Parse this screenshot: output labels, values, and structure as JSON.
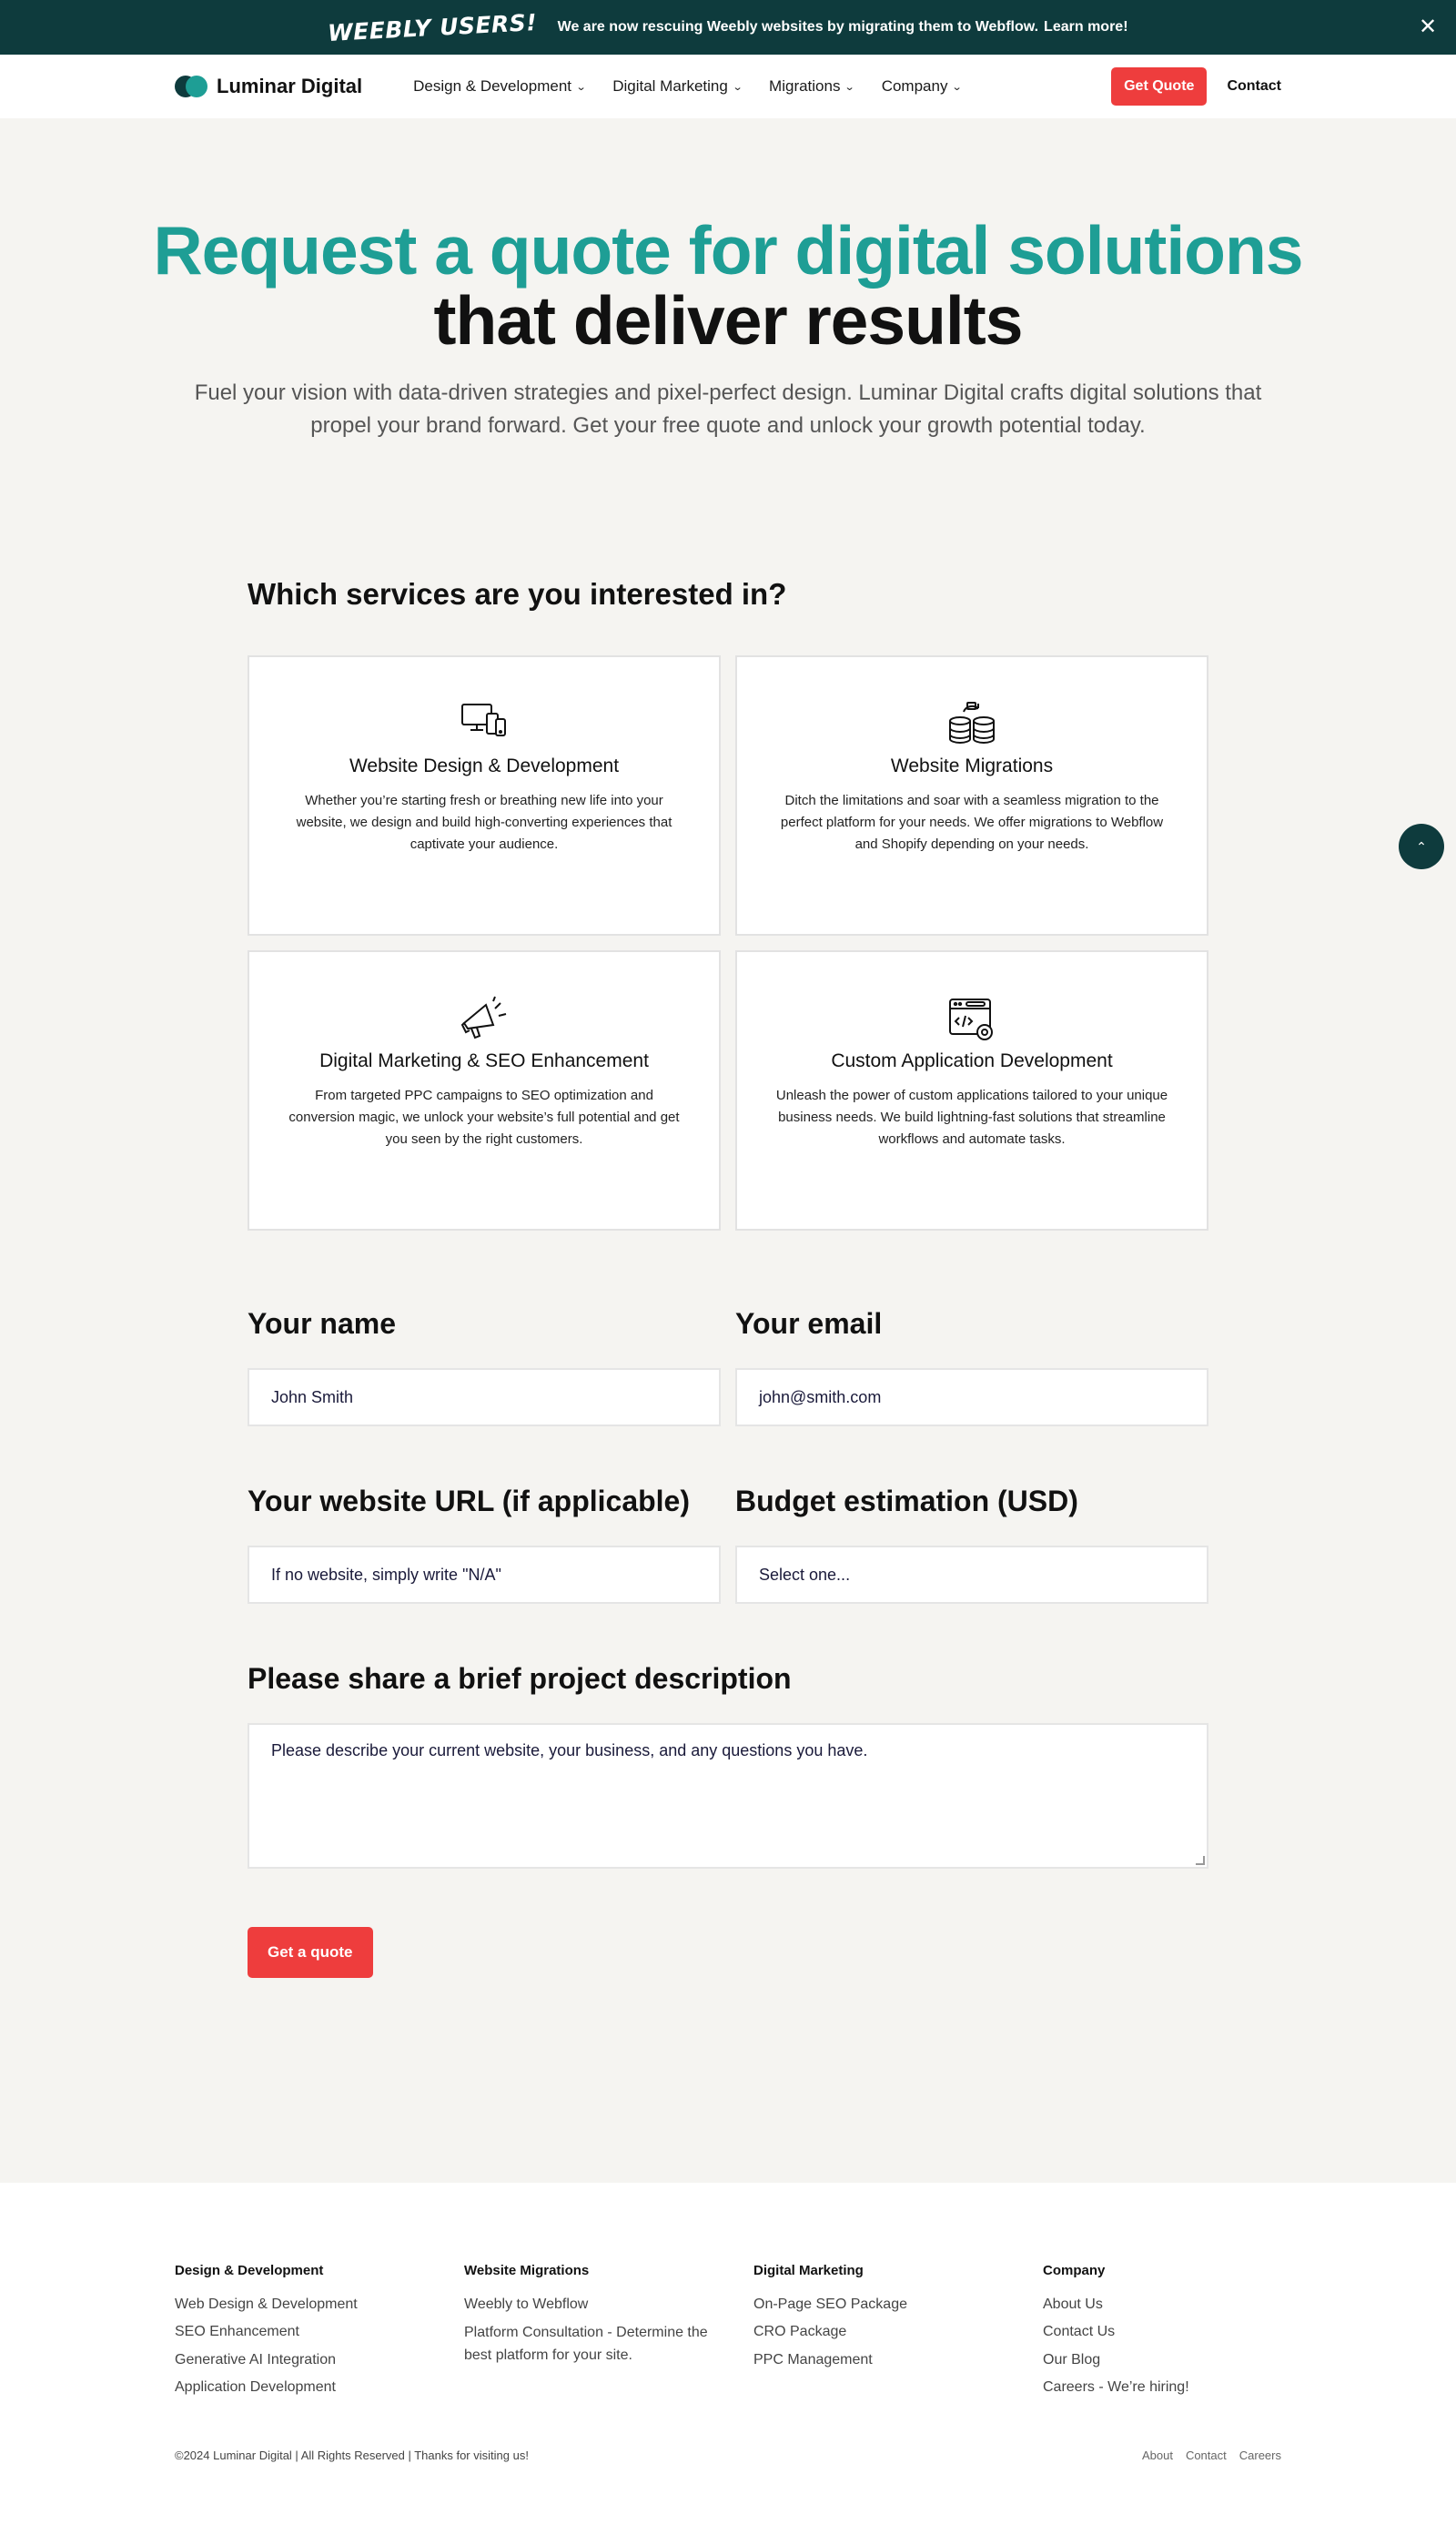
{
  "banner": {
    "title": "WEEBLY USERS!",
    "text": "We are now rescuing Weebly websites by migrating them to Webflow.",
    "link": "Learn more!",
    "close_icon": "close-icon"
  },
  "nav": {
    "logo_text": "Luminar Digital",
    "menu": [
      {
        "label": "Design & Development"
      },
      {
        "label": "Digital Marketing"
      },
      {
        "label": "Migrations"
      },
      {
        "label": "Company"
      }
    ],
    "cta": "Get Quote",
    "contact": "Contact"
  },
  "hero": {
    "line1": "Request a quote for digital solutions",
    "line2": "that deliver results",
    "subtitle": "Fuel your vision with data-driven strategies and pixel-perfect design. Luminar Digital crafts digital solutions that propel your brand forward. Get your free quote and unlock your growth potential today."
  },
  "services": {
    "heading": "Which services are you interested in?",
    "items": [
      {
        "title": "Website Design & Development",
        "desc": "Whether you’re starting fresh or breathing new life into your website, we design and build high-converting experiences that captivate your audience.",
        "icon": "devices-icon"
      },
      {
        "title": "Website Migrations",
        "desc": "Ditch the limitations and soar with a seamless migration to the perfect platform for your needs. We offer migrations to Webflow and Shopify depending on your needs.",
        "icon": "database-transfer-icon"
      },
      {
        "title": "Digital Marketing & SEO Enhancement",
        "desc": "From targeted PPC campaigns to SEO optimization and conversion magic, we unlock your website’s full potential and get you seen by the right customers.",
        "icon": "megaphone-icon"
      },
      {
        "title": "Custom Application Development",
        "desc": "Unleash the power of custom applications tailored to your unique business needs. We build lightning-fast solutions that streamline workflows and automate tasks.",
        "icon": "code-window-icon"
      }
    ]
  },
  "form": {
    "name_label": "Your name",
    "name_placeholder": "John Smith",
    "email_label": "Your email",
    "email_placeholder": "john@smith.com",
    "url_label": "Your website URL (if applicable)",
    "url_placeholder": "If no website, simply write \"N/A\"",
    "budget_label": "Budget estimation (USD)",
    "budget_selected": "Select one...",
    "desc_label": "Please share a brief project description",
    "desc_placeholder": "Please describe your current website, your business, and any questions you have.",
    "submit": "Get a quote"
  },
  "footer": {
    "columns": [
      {
        "heading": "Design & Development",
        "links": [
          "Web Design & Development",
          "SEO Enhancement",
          "Generative AI Integration",
          "Application Development"
        ]
      },
      {
        "heading": "Website Migrations",
        "links": [
          "Weebly to Webflow",
          "Platform Consultation - Determine the best platform for your site."
        ]
      },
      {
        "heading": "Digital Marketing",
        "links": [
          "On-Page SEO Package",
          "CRO Package",
          "PPC Management"
        ]
      },
      {
        "heading": "Company",
        "links": [
          "About Us",
          "Contact Us",
          "Our Blog",
          "Careers - We’re hiring!"
        ]
      }
    ],
    "copyright": "©2024 Luminar Digital | All Rights Reserved | Thanks for visiting us!",
    "bottom_links": [
      "About",
      "Contact",
      "Careers"
    ]
  },
  "colors": {
    "accent": "#1e9e95",
    "dark": "#0e3b3d",
    "cta": "#ee3d3d"
  }
}
